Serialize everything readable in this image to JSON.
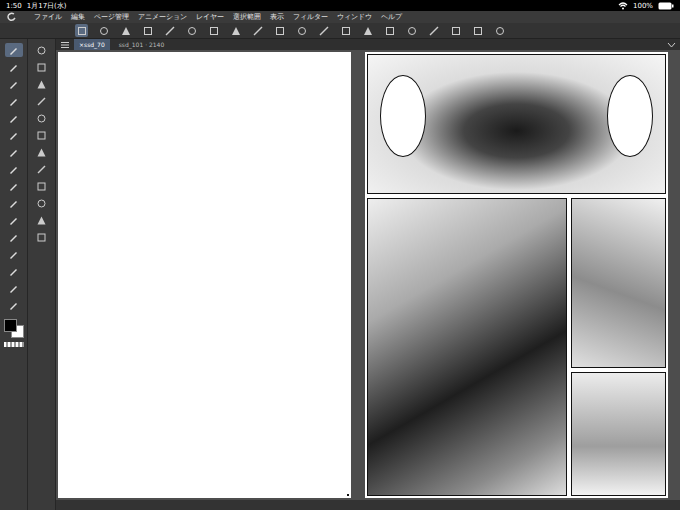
{
  "status_bar": {
    "time": "1:50",
    "date": "1月17日(水)",
    "battery": "100%"
  },
  "menu": [
    "ファイル",
    "編集",
    "ページ管理",
    "アニメーション",
    "レイヤー",
    "選択範囲",
    "表示",
    "フィルター",
    "ウィンドウ",
    "ヘルプ"
  ],
  "tabs": [
    {
      "label": "×ssd_70",
      "selected": true
    },
    {
      "label": "ssd_101 · 2140",
      "selected": false
    }
  ],
  "tools": [
    {
      "selected": true
    },
    {
      "selected": false
    },
    {
      "selected": false
    },
    {
      "selected": false
    },
    {
      "selected": false
    },
    {
      "selected": false
    },
    {
      "selected": false
    },
    {
      "selected": false
    },
    {
      "selected": false
    },
    {
      "selected": false
    },
    {
      "selected": false
    },
    {
      "selected": false
    },
    {
      "selected": false
    },
    {
      "selected": false
    },
    {
      "selected": false
    },
    {
      "selected": false
    }
  ],
  "colors": {
    "main": "#000000",
    "sub": "#ffffff"
  }
}
